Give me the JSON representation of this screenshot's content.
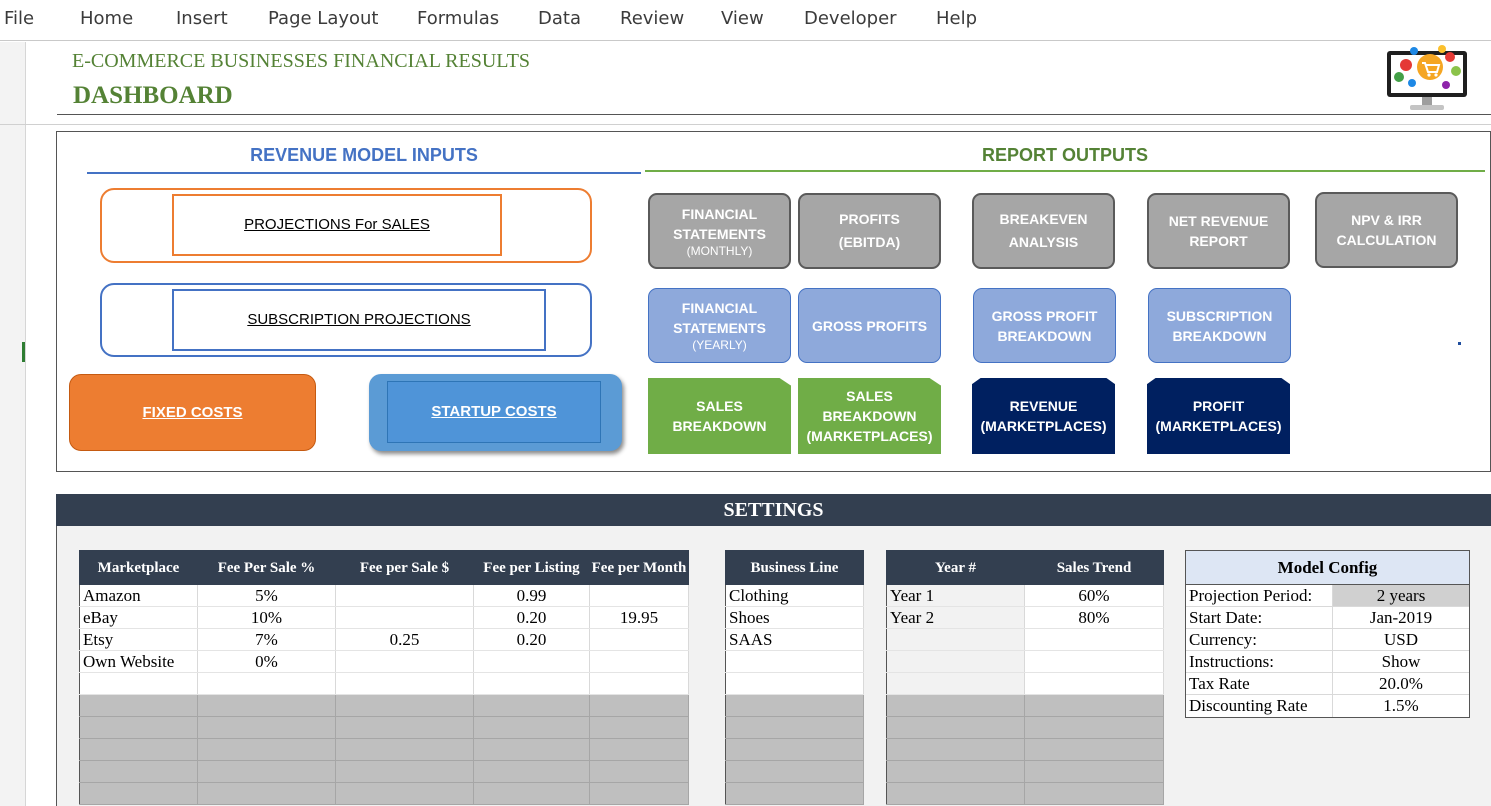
{
  "ribbon": {
    "tabs": [
      "File",
      "Home",
      "Insert",
      "Page Layout",
      "Formulas",
      "Data",
      "Review",
      "View",
      "Developer",
      "Help"
    ]
  },
  "header": {
    "subtitle": "E-COMMERCE BUSINESSES FINANCIAL RESULTS",
    "title": "DASHBOARD",
    "logo_icon": "computer-cart-icon"
  },
  "dashboard": {
    "inputs_heading": "REVENUE MODEL INPUTS",
    "outputs_heading": "REPORT OUTPUTS",
    "inputs": {
      "projections_sales": "PROJECTIONS For SALES",
      "subscription_projections": "SUBSCRIPTION PROJECTIONS",
      "fixed_costs": "FIXED COSTS",
      "startup_costs": "STARTUP COSTS"
    },
    "outputs": {
      "fs_monthly_1": "FINANCIAL",
      "fs_monthly_2": "STATEMENTS",
      "fs_monthly_3": "(MONTHLY)",
      "profits_1": "PROFITS",
      "profits_2": "(EBITDA)",
      "breakeven_1": "BREAKEVEN",
      "breakeven_2": "ANALYSIS",
      "net_revenue_1": "NET REVENUE",
      "net_revenue_2": "REPORT",
      "npv_1": "NPV & IRR",
      "npv_2": "CALCULATION",
      "fs_yearly_1": "FINANCIAL",
      "fs_yearly_2": "STATEMENTS",
      "fs_yearly_3": "(YEARLY)",
      "gross_profits": "GROSS PROFITS",
      "gp_breakdown_1": "GROSS PROFIT",
      "gp_breakdown_2": "BREAKDOWN",
      "sub_breakdown_1": "SUBSCRIPTION",
      "sub_breakdown_2": "BREAKDOWN",
      "sales_breakdown_1": "SALES",
      "sales_breakdown_2": "BREAKDOWN",
      "sales_mp_1": "SALES",
      "sales_mp_2": "BREAKDOWN",
      "sales_mp_3": "(MARKETPLACES)",
      "revenue_mp_1": "REVENUE",
      "revenue_mp_2": "(MARKETPLACES)",
      "profit_mp_1": "PROFIT",
      "profit_mp_2": "(MARKETPLACES)"
    }
  },
  "settings": {
    "title": "SETTINGS",
    "marketplace_table": {
      "headers": [
        "Marketplace",
        "Fee Per Sale %",
        "Fee per Sale $",
        "Fee per Listing",
        "Fee per Month"
      ],
      "rows": [
        [
          "Amazon",
          "5%",
          "",
          "0.99",
          ""
        ],
        [
          "eBay",
          "10%",
          "",
          "0.20",
          "19.95"
        ],
        [
          "Etsy",
          "7%",
          "0.25",
          "0.20",
          ""
        ],
        [
          "Own Website",
          "0%",
          "",
          "",
          ""
        ]
      ]
    },
    "business_line": {
      "header": "Business Line",
      "rows": [
        "Clothing",
        "Shoes",
        "SAAS"
      ]
    },
    "sales_trend": {
      "headers": [
        "Year #",
        "Sales Trend"
      ],
      "rows": [
        [
          "Year 1",
          "60%"
        ],
        [
          "Year 2",
          "80%"
        ]
      ]
    },
    "model_config": {
      "title": "Model Config",
      "rows": [
        {
          "label": "Projection Period:",
          "value": "2 years"
        },
        {
          "label": "Start Date:",
          "value": "Jan-2019"
        },
        {
          "label": "Currency:",
          "value": "USD"
        },
        {
          "label": "Instructions:",
          "value": "Show"
        },
        {
          "label": "Tax Rate",
          "value": "20.0%"
        },
        {
          "label": "Discounting Rate",
          "value": "1.5%"
        }
      ]
    }
  },
  "colors": {
    "title_green": "#548235",
    "inputs_blue": "#4472c4",
    "outputs_green": "#548235",
    "settings_navy": "#333f50",
    "orange": "#ed7d31",
    "navy_button": "#002060"
  }
}
